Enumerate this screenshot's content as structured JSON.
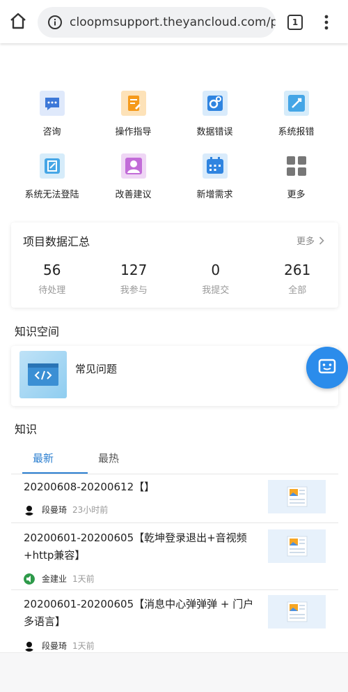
{
  "browser": {
    "url": "cloopmsupport.theyancloud.com/por",
    "tab_count": "1"
  },
  "grid": [
    {
      "label": "咨询",
      "icon": "chat-icon"
    },
    {
      "label": "操作指导",
      "icon": "guide-icon"
    },
    {
      "label": "数据错误",
      "icon": "data-error-icon"
    },
    {
      "label": "系统报错",
      "icon": "system-error-icon"
    },
    {
      "label": "系统无法登陆",
      "icon": "login-issue-icon"
    },
    {
      "label": "改善建议",
      "icon": "suggestion-icon"
    },
    {
      "label": "新增需求",
      "icon": "calendar-icon"
    },
    {
      "label": "更多",
      "icon": "more-grid-icon"
    }
  ],
  "summary": {
    "title": "项目数据汇总",
    "more": "更多",
    "stats": [
      {
        "value": "56",
        "label": "待处理"
      },
      {
        "value": "127",
        "label": "我参与"
      },
      {
        "value": "0",
        "label": "我提交"
      },
      {
        "value": "261",
        "label": "全部"
      }
    ]
  },
  "knowledge_space": {
    "title": "知识空间",
    "item": "常见问题"
  },
  "knowledge": {
    "title": "知识",
    "tabs": [
      "最新",
      "最热"
    ],
    "active_tab": "最新",
    "items": [
      {
        "title": "20200608-20200612【】",
        "author": "段曼琦",
        "time": "23小时前"
      },
      {
        "title": "20200601-20200605【乾坤登录退出+音视频+http兼容】",
        "author": "金建业",
        "time": "1天前"
      },
      {
        "title": "20200601-20200605【消息中心弹弹弹 + 门户多语言】",
        "author": "段曼琦",
        "time": "1天前"
      }
    ]
  },
  "colors": {
    "accent": "#2b7fd0",
    "fab": "#2b8ceb"
  }
}
